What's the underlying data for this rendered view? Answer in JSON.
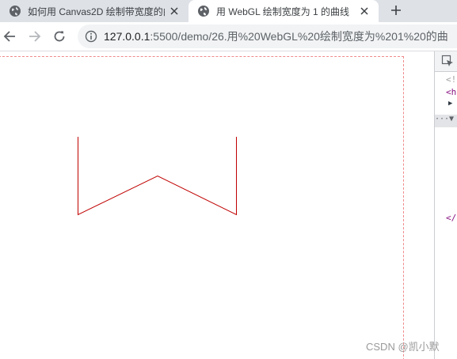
{
  "browser": {
    "tabs": [
      {
        "title": "如何用 Canvas2D 绘制带宽度的曲",
        "active": false
      },
      {
        "title": "用 WebGL 绘制宽度为 1 的曲线",
        "active": true
      }
    ],
    "new_tab_icon": "plus-icon",
    "url_host": "127.0.0.1",
    "url_path": ":5500/demo/26.用%20WebGL%20绘制宽度为%201%20的曲"
  },
  "page": {
    "curve_color": "#c00000",
    "watermark": "CSDN @凯小默"
  },
  "devtools": {
    "lines": [
      "<!",
      "<h",
      "▶",
      "···▼",
      "",
      "</"
    ]
  },
  "colors": {
    "tabstrip": "#dee1e6",
    "omnibox": "#f1f3f4",
    "canvas_outline": "#f08a8a",
    "devtools_tag": "#881280"
  }
}
